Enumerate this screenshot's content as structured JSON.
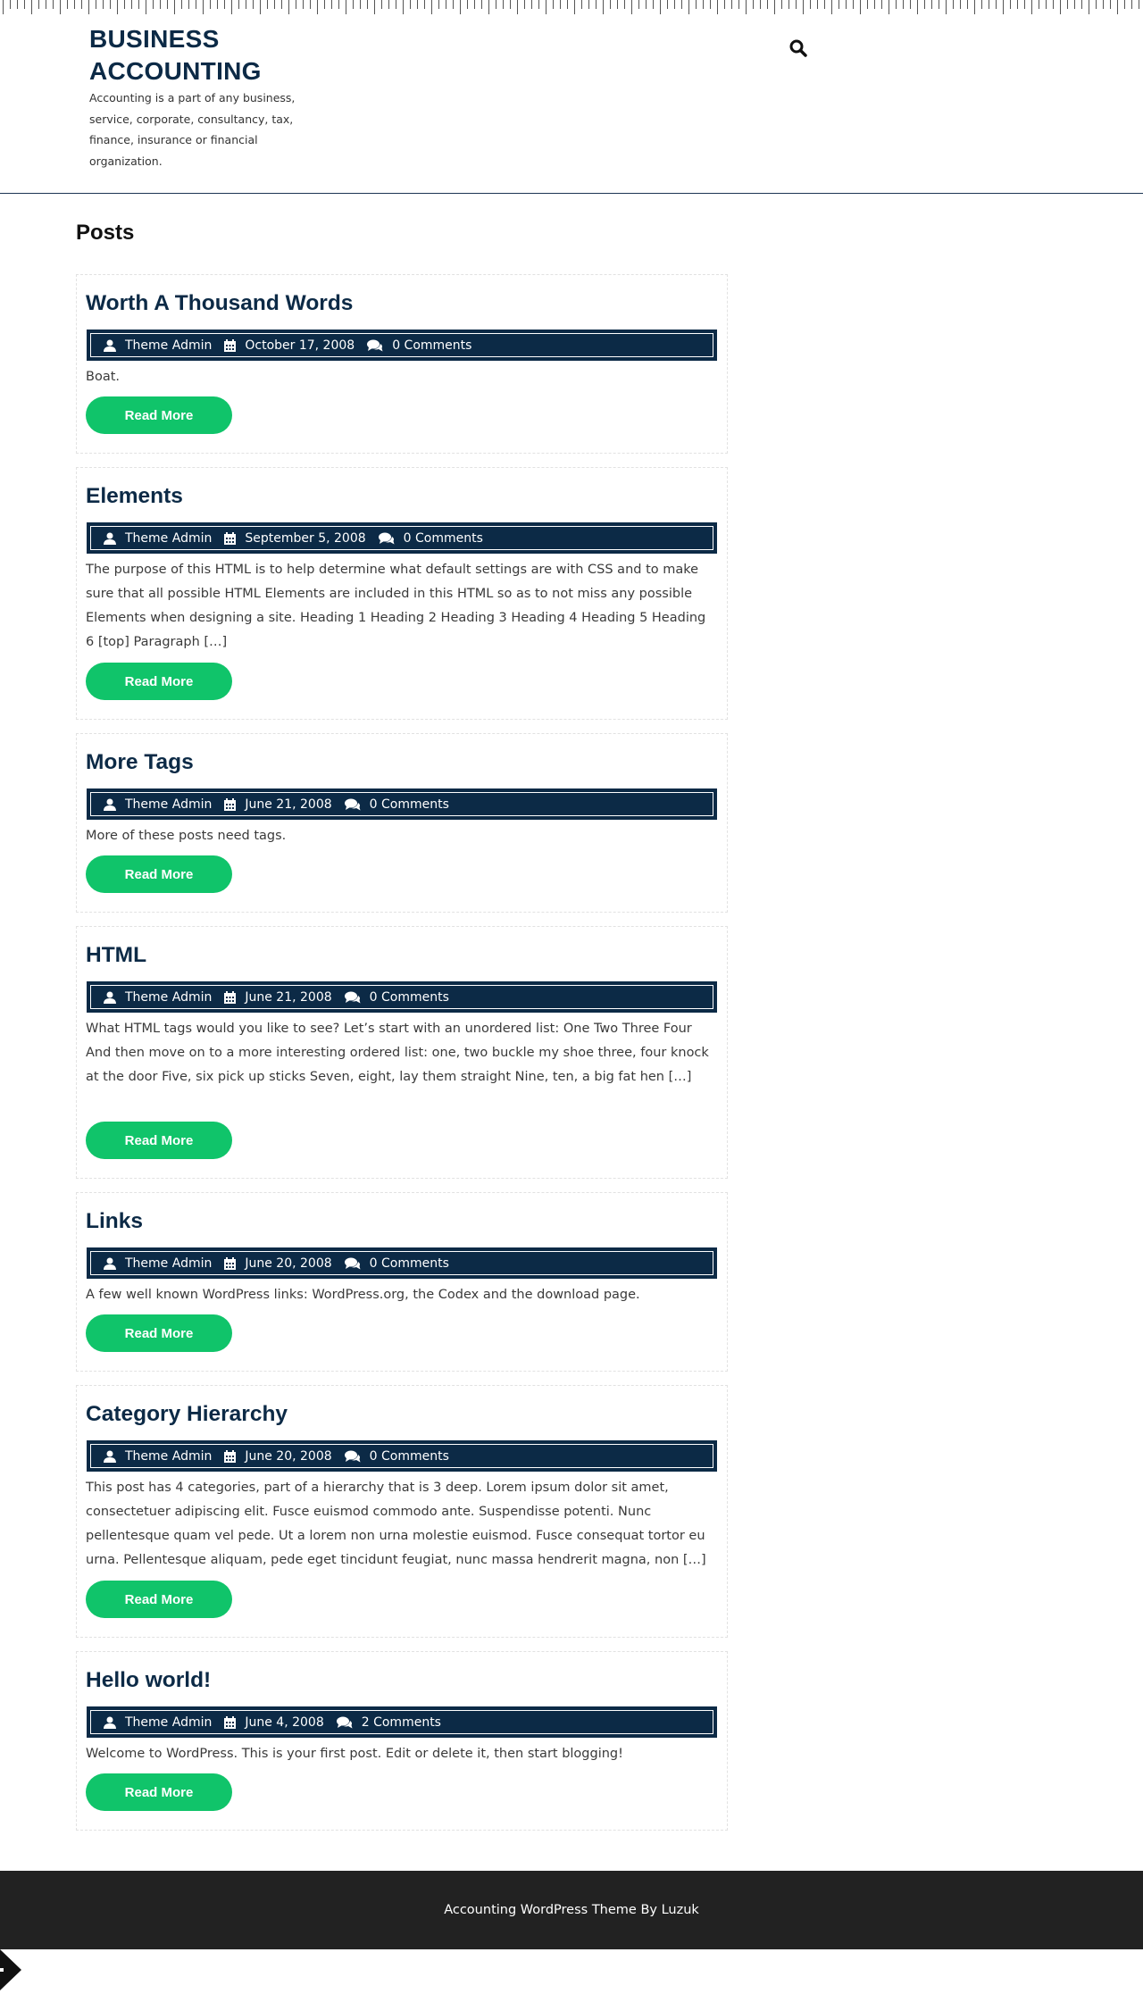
{
  "site": {
    "title": "BUSINESS ACCOUNTING",
    "description": "Accounting is a part of any business, service, corporate, consultancy, tax, finance, insurance or financial organization."
  },
  "header": {
    "search_icon": "search-icon"
  },
  "page": {
    "heading": "Posts"
  },
  "posts": [
    {
      "title": "Worth A Thousand Words",
      "author": "Theme Admin",
      "date": "October 17, 2008",
      "comments": "0 Comments",
      "excerpt": "Boat.",
      "read_more": "Read More"
    },
    {
      "title": "Elements",
      "author": "Theme Admin",
      "date": "September 5, 2008",
      "comments": "0 Comments",
      "excerpt": "The purpose of this HTML is to help determine what default settings are with CSS and to make sure that all possible HTML Elements are included in this HTML so as to not miss any possible Elements when designing a site. Heading 1 Heading 2 Heading 3 Heading 4 Heading 5 Heading 6 [top] Paragraph […]",
      "read_more": "Read More"
    },
    {
      "title": "More Tags",
      "author": "Theme Admin",
      "date": "June 21, 2008",
      "comments": "0 Comments",
      "excerpt": "More of these posts need tags.",
      "read_more": "Read More"
    },
    {
      "title": "HTML",
      "author": "Theme Admin",
      "date": "June 21, 2008",
      "comments": "0 Comments",
      "excerpt": "What HTML tags would you like to see? Let’s start with an unordered list: One Two Three Four And then move on to a more interesting ordered list: one, two buckle my shoe three, four knock at the door Five, six pick up sticks Seven, eight, lay them straight Nine, ten, a big fat hen […]",
      "read_more": "Read More"
    },
    {
      "title": "Links",
      "author": "Theme Admin",
      "date": "June 20, 2008",
      "comments": "0 Comments",
      "excerpt": "A few well known WordPress links: WordPress.org, the Codex and the download page.",
      "read_more": "Read More"
    },
    {
      "title": "Category Hierarchy",
      "author": "Theme Admin",
      "date": "June 20, 2008",
      "comments": "0 Comments",
      "excerpt": "This post has 4 categories, part of a hierarchy that is 3 deep. Lorem ipsum dolor sit amet, consectetuer adipiscing elit. Fusce euismod commodo ante. Suspendisse potenti. Nunc pellentesque quam vel pede. Ut a lorem non urna molestie euismod. Fusce consequat tortor eu urna. Pellentesque aliquam, pede eget tincidunt feugiat, nunc massa hendrerit magna, non […]",
      "read_more": "Read More"
    },
    {
      "title": "Hello world!",
      "author": "Theme Admin",
      "date": "June 4, 2008",
      "comments": "2 Comments",
      "excerpt": "Welcome to WordPress. This is your first post. Edit or delete it, then start blogging!",
      "read_more": "Read More"
    }
  ],
  "footer": {
    "credit": "Accounting WordPress Theme By Luzuk"
  },
  "colors": {
    "navy": "#0c2a46",
    "green": "#10c46a",
    "footer": "#222222"
  }
}
